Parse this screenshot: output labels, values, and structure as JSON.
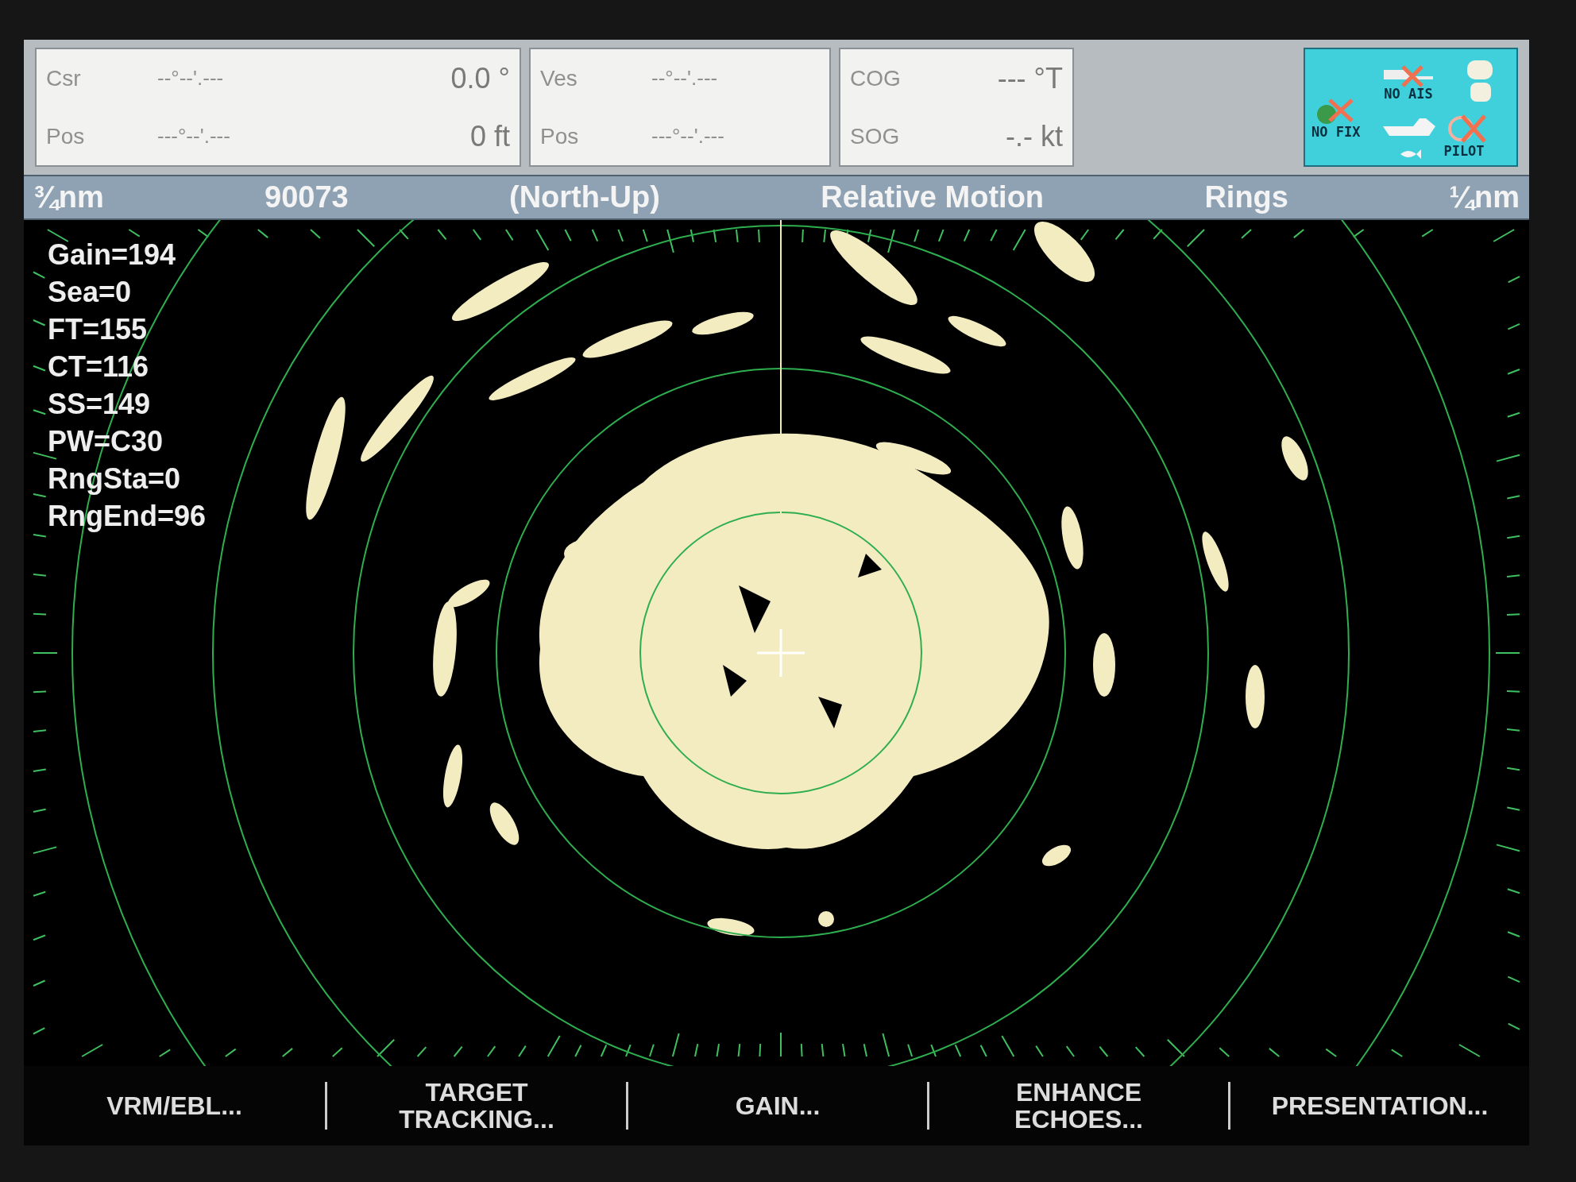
{
  "info_panels": [
    {
      "rows": [
        {
          "label": "Csr",
          "coord": "--°--'.---",
          "value": "0.0 °"
        },
        {
          "label": "Pos",
          "coord": "---°--'.---",
          "value": "0 ft"
        }
      ]
    },
    {
      "rows": [
        {
          "label": "Ves",
          "coord": "--°--'.---"
        },
        {
          "label": "Pos",
          "coord": "---°--'.---"
        }
      ]
    },
    {
      "rows": [
        {
          "label": "COG",
          "value": "--- °T"
        },
        {
          "label": "SOG",
          "value": "-.- kt"
        }
      ]
    }
  ],
  "status_icons": [
    {
      "kind": "fix",
      "label": "NO FIX"
    },
    {
      "kind": "ais",
      "label": "NO AIS"
    },
    {
      "kind": "pilot",
      "label": "PILOT"
    }
  ],
  "status_bar": [
    "¾nm",
    "90073",
    "(North-Up)",
    "Relative Motion",
    "Rings",
    "¼nm"
  ],
  "readouts": [
    "Gain=194",
    "Sea=0",
    "FT=155",
    "CT=116",
    "SS=149",
    "PW=C30",
    "RngSta=0",
    "RngEnd=96"
  ],
  "softkeys": [
    [
      "VRM/EBL..."
    ],
    [
      "TARGET",
      "TRACKING..."
    ],
    [
      "GAIN..."
    ],
    [
      "ENHANCE",
      "ECHOES..."
    ],
    [
      "PRESENTATION..."
    ]
  ]
}
